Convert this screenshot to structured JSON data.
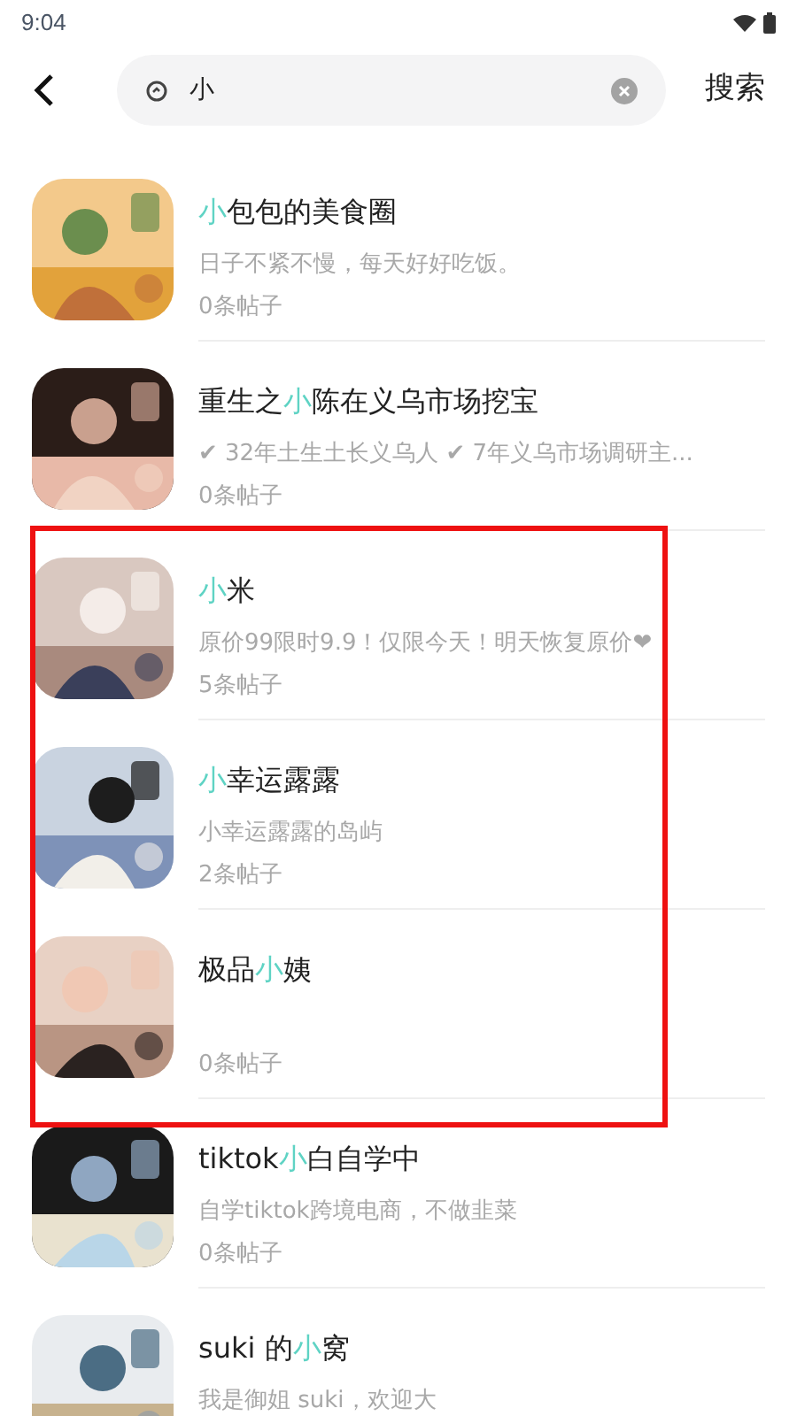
{
  "status_bar": {
    "time": "9:04"
  },
  "search": {
    "value": "小",
    "button": "搜索"
  },
  "results": [
    {
      "title_parts": [
        {
          "text": "小",
          "highlighted": true
        },
        {
          "text": "包包的美食圈",
          "highlighted": false
        }
      ],
      "description": "日子不紧不慢，每天好好吃饭。",
      "posts": "0条帖子",
      "avatar": {
        "kind": "picture"
      }
    },
    {
      "title_parts": [
        {
          "text": "重生之",
          "highlighted": false
        },
        {
          "text": "小",
          "highlighted": true
        },
        {
          "text": "陈在义乌市场挖宝",
          "highlighted": false
        }
      ],
      "description": "✔ 32年土生土长义乌人 ✔ 7年义乌市场调研主...",
      "posts": "0条帖子",
      "avatar": {
        "kind": "picture"
      }
    },
    {
      "title_parts": [
        {
          "text": "小",
          "highlighted": true
        },
        {
          "text": "米",
          "highlighted": false
        }
      ],
      "description": "原价99限时9.9！仅限今天！明天恢复原价❤",
      "posts": "5条帖子",
      "avatar": {
        "kind": "picture"
      }
    },
    {
      "title_parts": [
        {
          "text": "小",
          "highlighted": true
        },
        {
          "text": "幸运露露",
          "highlighted": false
        }
      ],
      "description": "小幸运露露的岛屿",
      "posts": "2条帖子",
      "avatar": {
        "kind": "picture"
      }
    },
    {
      "title_parts": [
        {
          "text": "极品",
          "highlighted": false
        },
        {
          "text": "小",
          "highlighted": true
        },
        {
          "text": "姨",
          "highlighted": false
        }
      ],
      "posts": "0条帖子",
      "avatar": {
        "kind": "picture"
      }
    },
    {
      "title_parts": [
        {
          "text": "tiktok",
          "highlighted": false
        },
        {
          "text": "小",
          "highlighted": true
        },
        {
          "text": "白自学中",
          "highlighted": false
        }
      ],
      "description": "自学tiktok跨境电商，不做韭菜",
      "posts": "0条帖子",
      "avatar": {
        "kind": "picture"
      }
    },
    {
      "title_parts": [
        {
          "text": "suki 的",
          "highlighted": false
        },
        {
          "text": "小",
          "highlighted": true
        },
        {
          "text": "窝",
          "highlighted": false
        }
      ],
      "description": "我是御姐 suki，欢迎大",
      "avatar": {
        "kind": "picture"
      }
    }
  ]
}
